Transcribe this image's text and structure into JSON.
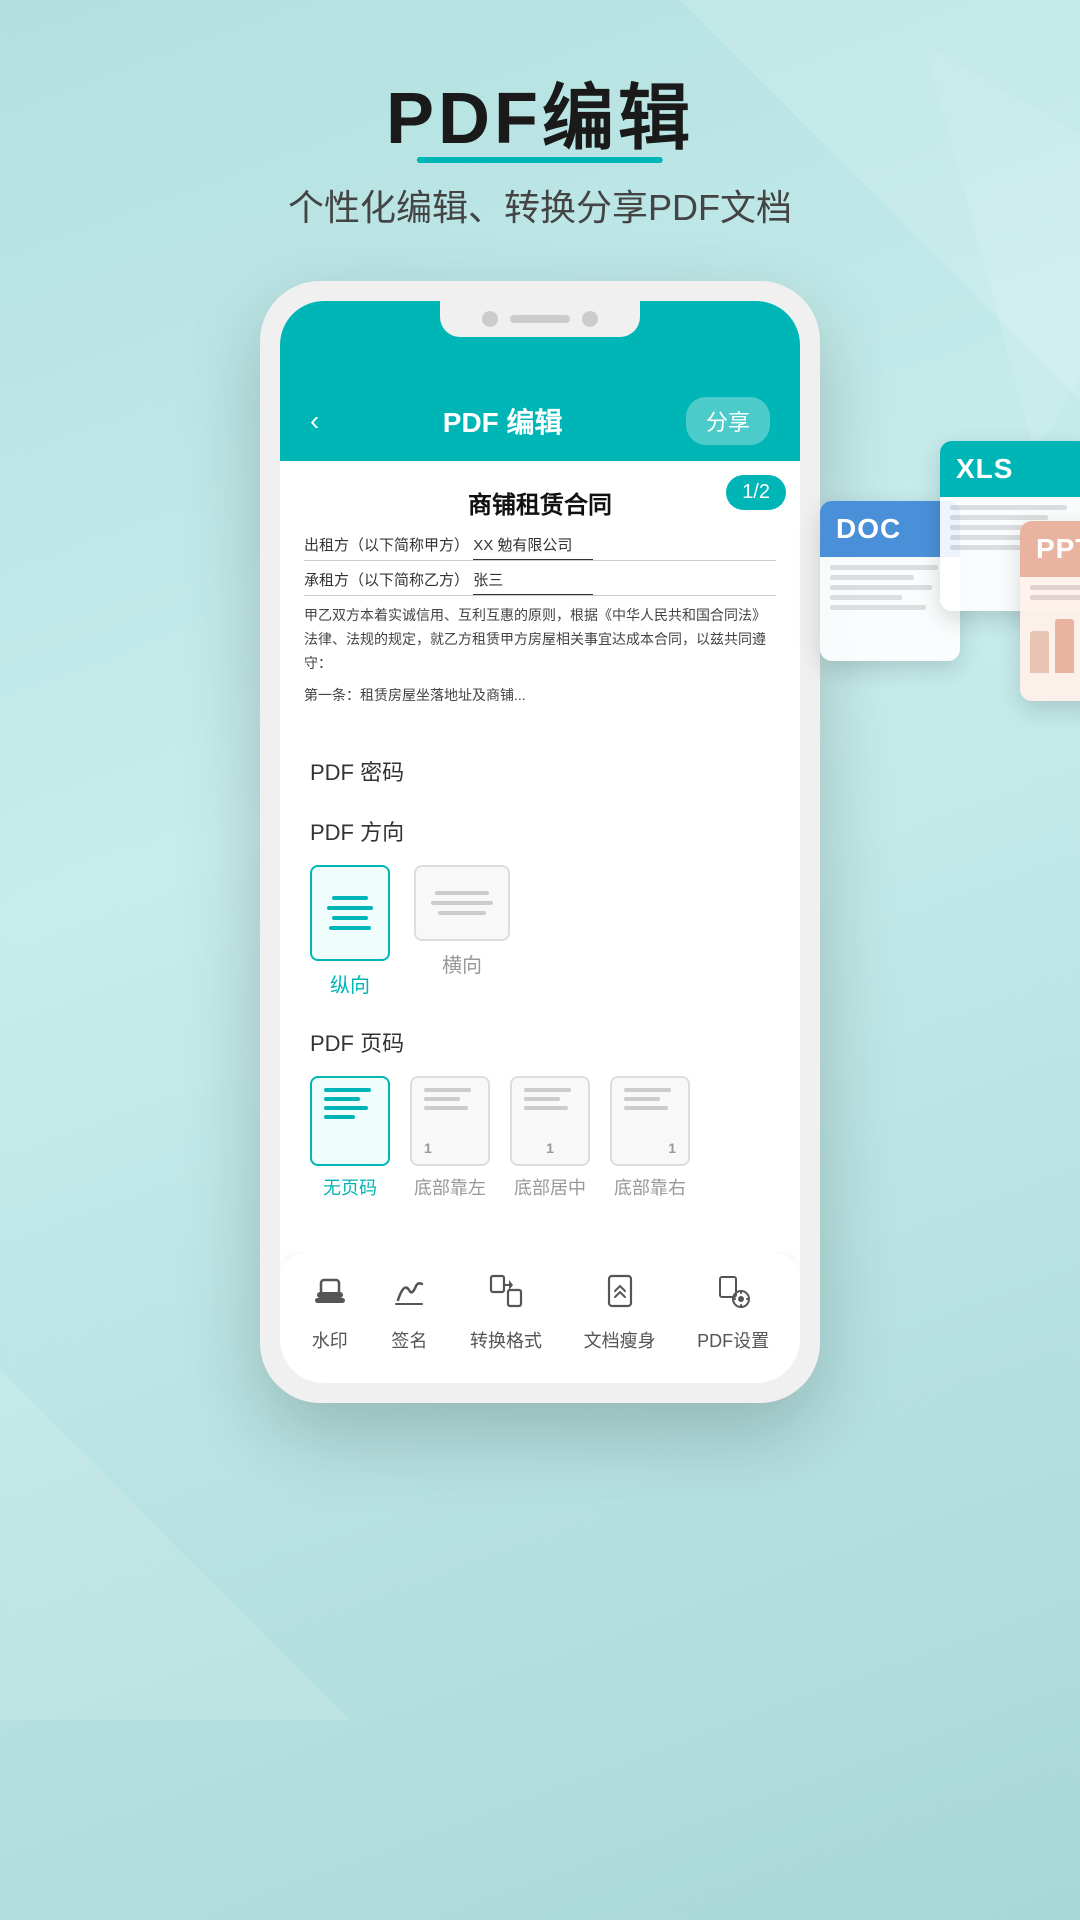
{
  "header": {
    "title": "PDF编辑",
    "subtitle": "个性化编辑、转换分享PDF文档"
  },
  "phone": {
    "nav": {
      "back": "‹",
      "title": "PDF 编辑",
      "share": "分享"
    },
    "pageBadge": "1/2",
    "document": {
      "title": "商铺租赁合同",
      "line1_label": "出租方（以下简称甲方）",
      "line1_value": "XX 勉有限公司",
      "line2_label": "承租方（以下简称乙方）",
      "line2_value": "张三",
      "paragraph": "甲乙双方本着实诚信用、互利互惠的原则，根据《中华人民共和国合同法》法律、法规的规定，就乙方租赁甲方房屋相关事宜达成本合同，以兹共同遵守：",
      "para2": "第一条：租赁房屋坐落地址及商铺..."
    }
  },
  "settings": {
    "password_label": "PDF 密码",
    "direction_label": "PDF 方向",
    "orientation_options": [
      {
        "label": "纵向",
        "active": true
      },
      {
        "label": "横向",
        "active": false
      }
    ],
    "pageno_label": "PDF 页码",
    "pageno_options": [
      {
        "label": "无页码",
        "active": true,
        "number": ""
      },
      {
        "label": "底部靠左",
        "active": false,
        "number": "1"
      },
      {
        "label": "底部居中",
        "active": false,
        "number": "1"
      },
      {
        "label": "底部靠右",
        "active": false,
        "number": "1"
      }
    ]
  },
  "toolbar": {
    "items": [
      {
        "label": "水印",
        "icon": "stamp"
      },
      {
        "label": "签名",
        "icon": "signature"
      },
      {
        "label": "转换格式",
        "icon": "convert"
      },
      {
        "label": "文档瘦身",
        "icon": "compress"
      },
      {
        "label": "PDF设置",
        "icon": "settings"
      }
    ]
  },
  "floating_docs": [
    {
      "type": "DOC",
      "color": "blue"
    },
    {
      "type": "XLS",
      "color": "teal"
    },
    {
      "type": "PPT",
      "color": "pink"
    }
  ]
}
